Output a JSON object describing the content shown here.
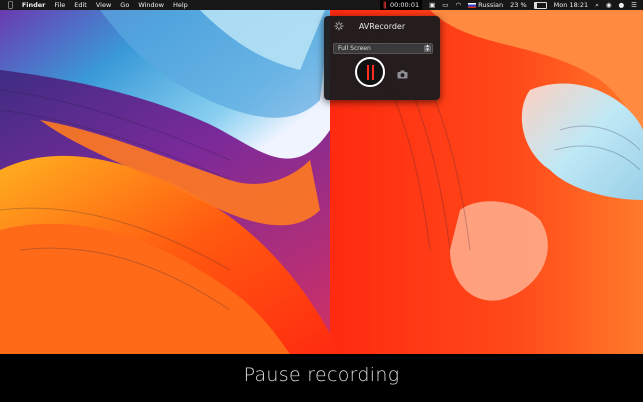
{
  "menubar": {
    "apple_icon": "apple-logo",
    "app_name": "Finder",
    "menus": [
      "File",
      "Edit",
      "View",
      "Go",
      "Window",
      "Help"
    ],
    "recording_time": "00:00:01",
    "input_source": "Russian",
    "battery_percent": "23 %",
    "battery_level": 0.23,
    "clock": "Mon 18:21"
  },
  "panel": {
    "title": "AVRecorder",
    "source_selected": "Full Screen",
    "record_button_state": "recording",
    "accent_color": "#ff2d20"
  },
  "caption": "Pause recording"
}
